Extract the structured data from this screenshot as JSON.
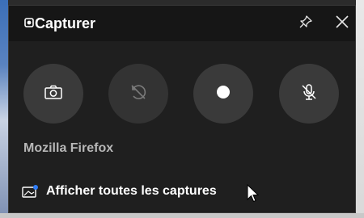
{
  "widget": {
    "title": "Capturer",
    "title_icon": "capture-widget-icon",
    "pin_icon": "pin-icon",
    "close_icon": "close-icon"
  },
  "buttons": [
    {
      "name": "screenshot",
      "icon": "camera-icon",
      "enabled": true
    },
    {
      "name": "record-last-30s",
      "icon": "record-last-icon",
      "enabled": false
    },
    {
      "name": "start-recording",
      "icon": "record-dot-icon",
      "enabled": true
    },
    {
      "name": "microphone",
      "icon": "mic-off-icon",
      "enabled": true
    }
  ],
  "source": {
    "app_name": "Mozilla Firefox"
  },
  "gallery": {
    "label": "Afficher toutes les captures",
    "icon": "gallery-icon"
  },
  "colors": {
    "panel_bg": "#1f1f1f",
    "titlebar_bg": "#161616",
    "button_bg": "#3a3a3a",
    "accent_blue": "#2f7cf6"
  }
}
